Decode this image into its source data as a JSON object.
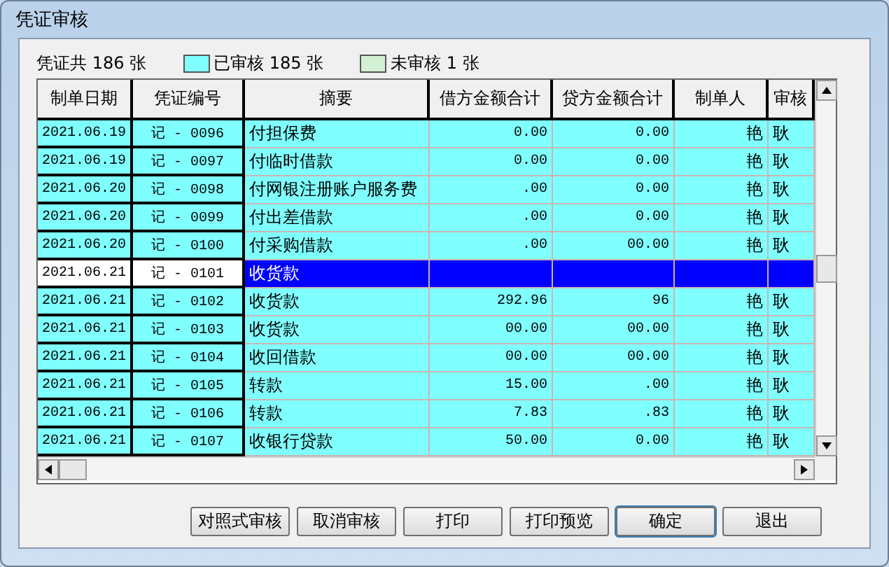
{
  "window": {
    "title": "凭证审核"
  },
  "summary": {
    "total": "凭证共 186 张",
    "legend": [
      {
        "label": "已审核 185 张",
        "color": "#80ffff"
      },
      {
        "label": "未审核 1 张",
        "color": "#d4f0d4"
      }
    ]
  },
  "table": {
    "columns": [
      "制单日期",
      "凭证编号",
      "摘要",
      "借方金额合计",
      "贷方金额合计",
      "制单人",
      "审核"
    ],
    "rows": [
      {
        "date": "2021.06.19",
        "number": "记 - 0096",
        "summary": "付担保费",
        "debit": "0.00",
        "credit": "0.00",
        "maker": "艳",
        "auditor": "耿",
        "selected": false
      },
      {
        "date": "2021.06.19",
        "number": "记 - 0097",
        "summary": "付临时借款",
        "debit": "0.00",
        "credit": "0.00",
        "maker": "艳",
        "auditor": "耿",
        "selected": false
      },
      {
        "date": "2021.06.20",
        "number": "记 - 0098",
        "summary": "付网银注册账户服务费",
        "debit": ".00",
        "credit": "0.00",
        "maker": "艳",
        "auditor": "耿",
        "selected": false
      },
      {
        "date": "2021.06.20",
        "number": "记 - 0099",
        "summary": "付出差借款",
        "debit": ".00",
        "credit": "0.00",
        "maker": "艳",
        "auditor": "耿",
        "selected": false
      },
      {
        "date": "2021.06.20",
        "number": "记 - 0100",
        "summary": "付采购借款",
        "debit": ".00",
        "credit": "00.00",
        "maker": "艳",
        "auditor": "耿",
        "selected": false
      },
      {
        "date": "2021.06.21",
        "number": "记 - 0101",
        "summary": "收货款",
        "selected": true
      },
      {
        "date": "2021.06.21",
        "number": "记 - 0102",
        "summary": "收货款",
        "debit": "292.96",
        "credit": "96",
        "maker": "艳",
        "auditor": "耿",
        "selected": false
      },
      {
        "date": "2021.06.21",
        "number": "记 - 0103",
        "summary": "收货款",
        "debit": "00.00",
        "credit": "00.00",
        "maker": "艳",
        "auditor": "耿",
        "selected": false
      },
      {
        "date": "2021.06.21",
        "number": "记 - 0104",
        "summary": "收回借款",
        "debit": "00.00",
        "credit": "00.00",
        "maker": "艳",
        "auditor": "耿",
        "selected": false
      },
      {
        "date": "2021.06.21",
        "number": "记 - 0105",
        "summary": "转款",
        "debit": "15.00",
        "credit": ".00",
        "maker": "艳",
        "auditor": "耿",
        "selected": false
      },
      {
        "date": "2021.06.21",
        "number": "记 - 0106",
        "summary": "转款",
        "debit": "7.83",
        "credit": ".83",
        "maker": "艳",
        "auditor": "耿",
        "selected": false
      },
      {
        "date": "2021.06.21",
        "number": "记 - 0107",
        "summary": "收银行贷款",
        "debit": "50.00",
        "credit": "0.00",
        "maker": "艳",
        "auditor": "耿",
        "selected": false
      }
    ]
  },
  "buttons": [
    "对照式审核",
    "取消审核",
    "打印",
    "打印预览",
    "确定",
    "退出"
  ]
}
